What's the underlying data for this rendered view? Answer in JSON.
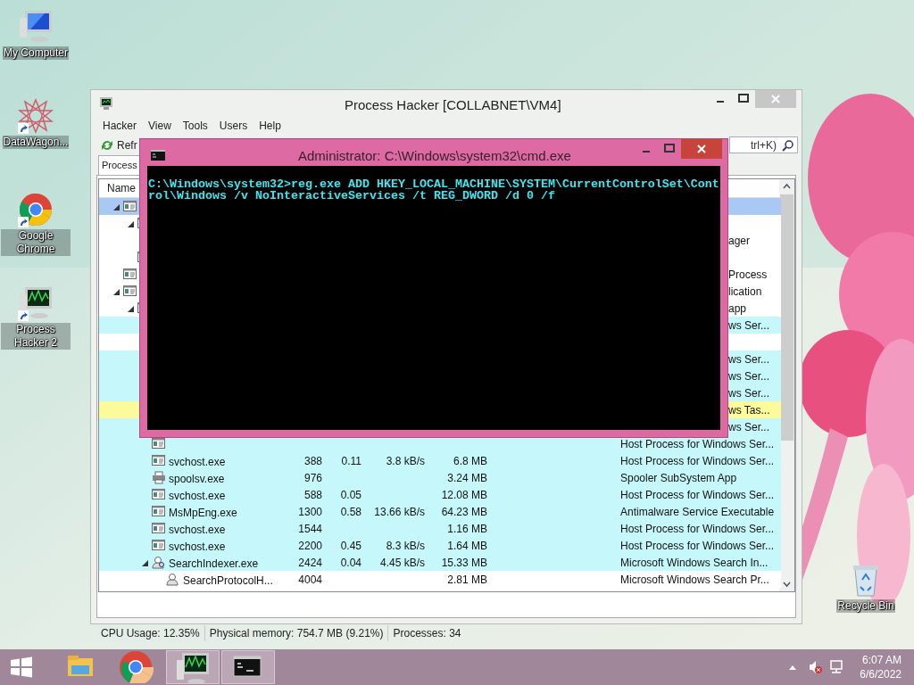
{
  "desktop_icons": [
    {
      "kind": "computer",
      "label": "My Computer",
      "shortcut": false
    },
    {
      "kind": "star",
      "label": "DataWagon...",
      "shortcut": true
    },
    {
      "kind": "chrome",
      "label": "Google Chrome",
      "shortcut": true
    },
    {
      "kind": "monitor",
      "label": "Process Hacker 2",
      "shortcut": true
    },
    {
      "kind": "bin",
      "label": "Recycle Bin",
      "shortcut": false
    }
  ],
  "process_hacker": {
    "title": "Process Hacker [COLLABNET\\VM4]",
    "menu": [
      "Hacker",
      "View",
      "Tools",
      "Users",
      "Help"
    ],
    "toolbar": {
      "refresh": "Refr",
      "search_placeholder": "trl+K)"
    },
    "tabs": [
      {
        "label": "Process",
        "selected": true
      }
    ],
    "columns": [
      "Name"
    ],
    "rows": [
      {
        "kind": "covered",
        "selected": true,
        "expanded": true,
        "children": [
          {
            "kind": "covered",
            "selected": false,
            "color": "#ffffff",
            "expanded": true,
            "children": [
              {
                "kind": "covered",
                "selected": false,
                "color": "#ffffff",
                "description": "ager"
              }
            ]
          },
          {
            "kind": "covered",
            "selected": false,
            "color": "#ffffff"
          }
        ]
      },
      {
        "kind": "covered",
        "selected": false,
        "color": "#ffffff",
        "description": "Process"
      },
      {
        "kind": "covered",
        "selected": false,
        "color": "#ffffff",
        "description": "lication",
        "expanded": true,
        "children": [
          {
            "kind": "covered",
            "selected": false,
            "color": "#ffffff",
            "description": "app",
            "expanded": true,
            "children": [
              {
                "kind": "covered",
                "selected": false,
                "color": "#c6f8fb",
                "description": "ws Ser..."
              },
              {
                "kind": "covered",
                "selected": false,
                "color": "#ffffff"
              },
              {
                "kind": "covered",
                "selected": false,
                "color": "#c6f8fb",
                "description": "ws Ser..."
              },
              {
                "kind": "covered",
                "selected": false,
                "color": "#c6f8fb",
                "description": "ws Ser..."
              },
              {
                "kind": "covered",
                "selected": false,
                "color": "#c6f8fb",
                "description": "ws Ser..."
              },
              {
                "kind": "covered",
                "selected": false,
                "color": "#fdfa9c",
                "description": "ws Tas..."
              },
              {
                "kind": "covered",
                "selected": false,
                "color": "#c6f8fb",
                "description": "ws Ser..."
              },
              {
                "kind": "app",
                "selected": false,
                "color": "#c6f8fb",
                "description": "Host Process for Windows Ser..."
              },
              {
                "kind": "app",
                "selected": false,
                "color": "#c6f8fb",
                "name": "svchost.exe",
                "pid": "388",
                "cpu": "0.11",
                "io": "3.8 kB/s",
                "memory": "6.8 MB",
                "description": "Host Process for Windows Ser..."
              },
              {
                "kind": "printer",
                "selected": false,
                "color": "#c6f8fb",
                "name": "spoolsv.exe",
                "pid": "976",
                "memory": "3.24 MB",
                "description": "Spooler SubSystem App"
              },
              {
                "kind": "app",
                "selected": false,
                "color": "#c6f8fb",
                "name": "svchost.exe",
                "pid": "588",
                "cpu": "0.05",
                "memory": "12.08 MB",
                "description": "Host Process for Windows Ser..."
              },
              {
                "kind": "app",
                "selected": false,
                "color": "#c6f8fb",
                "name": "MsMpEng.exe",
                "pid": "1300",
                "cpu": "0.58",
                "io": "13.66 kB/s",
                "memory": "64.23 MB",
                "description": "Antimalware Service Executable"
              },
              {
                "kind": "app",
                "selected": false,
                "color": "#c6f8fb",
                "name": "svchost.exe",
                "pid": "1544",
                "memory": "1.16 MB",
                "description": "Host Process for Windows Ser..."
              },
              {
                "kind": "app",
                "selected": false,
                "color": "#c6f8fb",
                "name": "svchost.exe",
                "pid": "2200",
                "cpu": "0.45",
                "io": "8.3 kB/s",
                "memory": "1.64 MB",
                "description": "Host Process for Windows Ser..."
              },
              {
                "kind": "search",
                "selected": false,
                "color": "#c6f8fb",
                "name": "SearchIndexer.exe",
                "pid": "2424",
                "cpu": "0.04",
                "io": "4.45 kB/s",
                "memory": "15.33 MB",
                "description": "Microsoft Windows Search In...",
                "expanded": true,
                "children": [
                  {
                    "kind": "user",
                    "selected": false,
                    "color": "#ffffff",
                    "name": "SearchProtocolH...",
                    "pid": "4004",
                    "memory": "2.81 MB",
                    "description": "Microsoft Windows Search Pr..."
                  }
                ]
              }
            ]
          }
        ]
      }
    ],
    "status_bar": [
      "CPU Usage: 12.35%",
      "Physical memory: 754.7 MB (9.21%)",
      "Processes: 34"
    ]
  },
  "cmd_window": {
    "title": "Administrator: C:\\Windows\\system32\\cmd.exe",
    "lines": [
      "C:\\Windows\\system32>reg.exe ADD HKEY_LOCAL_MACHINE\\SYSTEM\\CurrentControlSet\\Cont",
      "rol\\Windows /v NoInteractiveServices /t REG_DWORD /d 0 /f"
    ]
  },
  "taskbar": {
    "apps": [
      {
        "kind": "explorer",
        "active": false
      },
      {
        "kind": "chrome",
        "active": false
      },
      {
        "kind": "monitor",
        "active": true
      },
      {
        "kind": "console",
        "active": true
      }
    ],
    "time": "6:07 AM",
    "date": "6/6/2022"
  }
}
